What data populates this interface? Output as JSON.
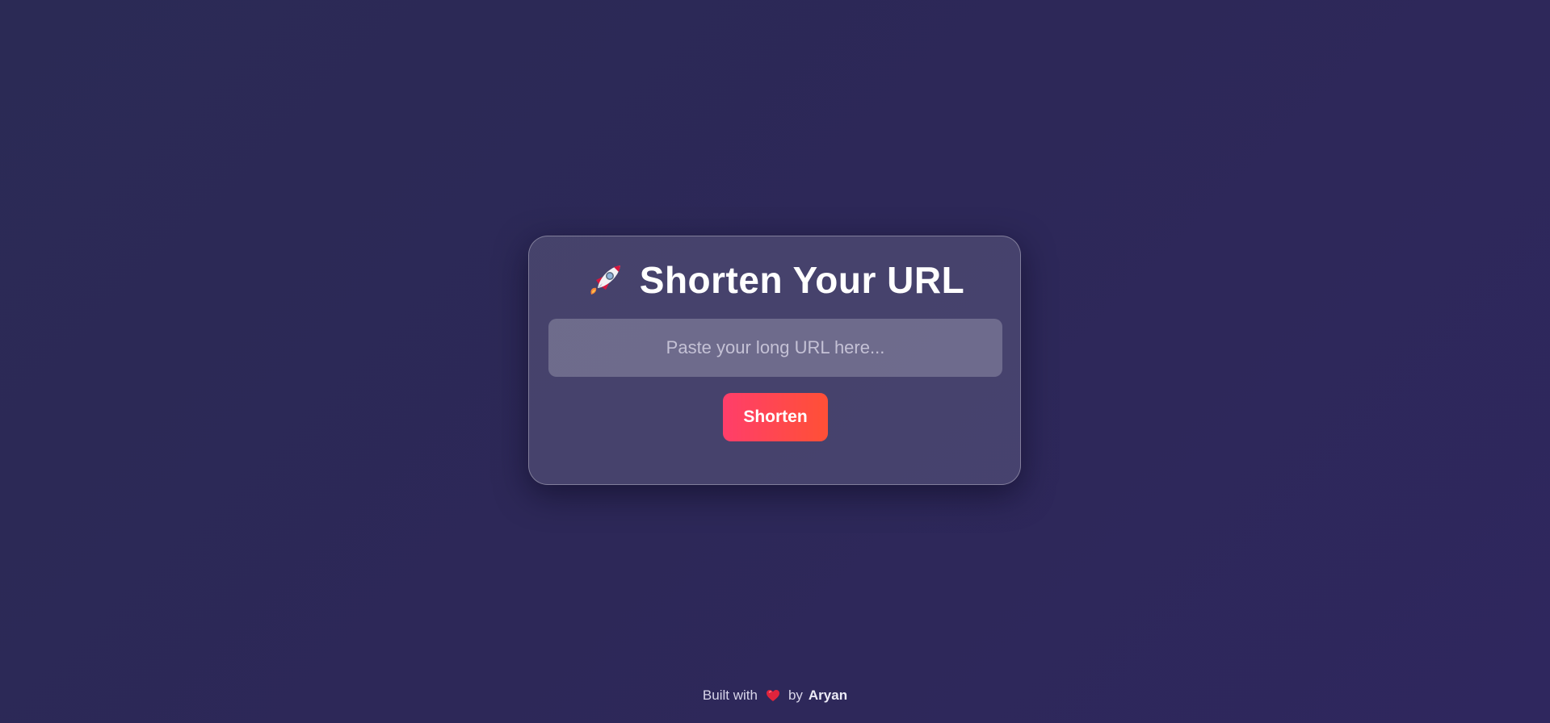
{
  "card": {
    "title": "Shorten Your URL",
    "title_icon": "rocket-icon",
    "input": {
      "placeholder": "Paste your long URL here...",
      "value": ""
    },
    "button_label": "Shorten"
  },
  "footer": {
    "prefix": "Built with",
    "icon": "heart-icon",
    "by": "by",
    "author": "Aryan"
  },
  "colors": {
    "background": "#2d2858",
    "button_gradient_start": "#ff3e6a",
    "button_gradient_end": "#ff5036",
    "heart": "#e0243c"
  }
}
